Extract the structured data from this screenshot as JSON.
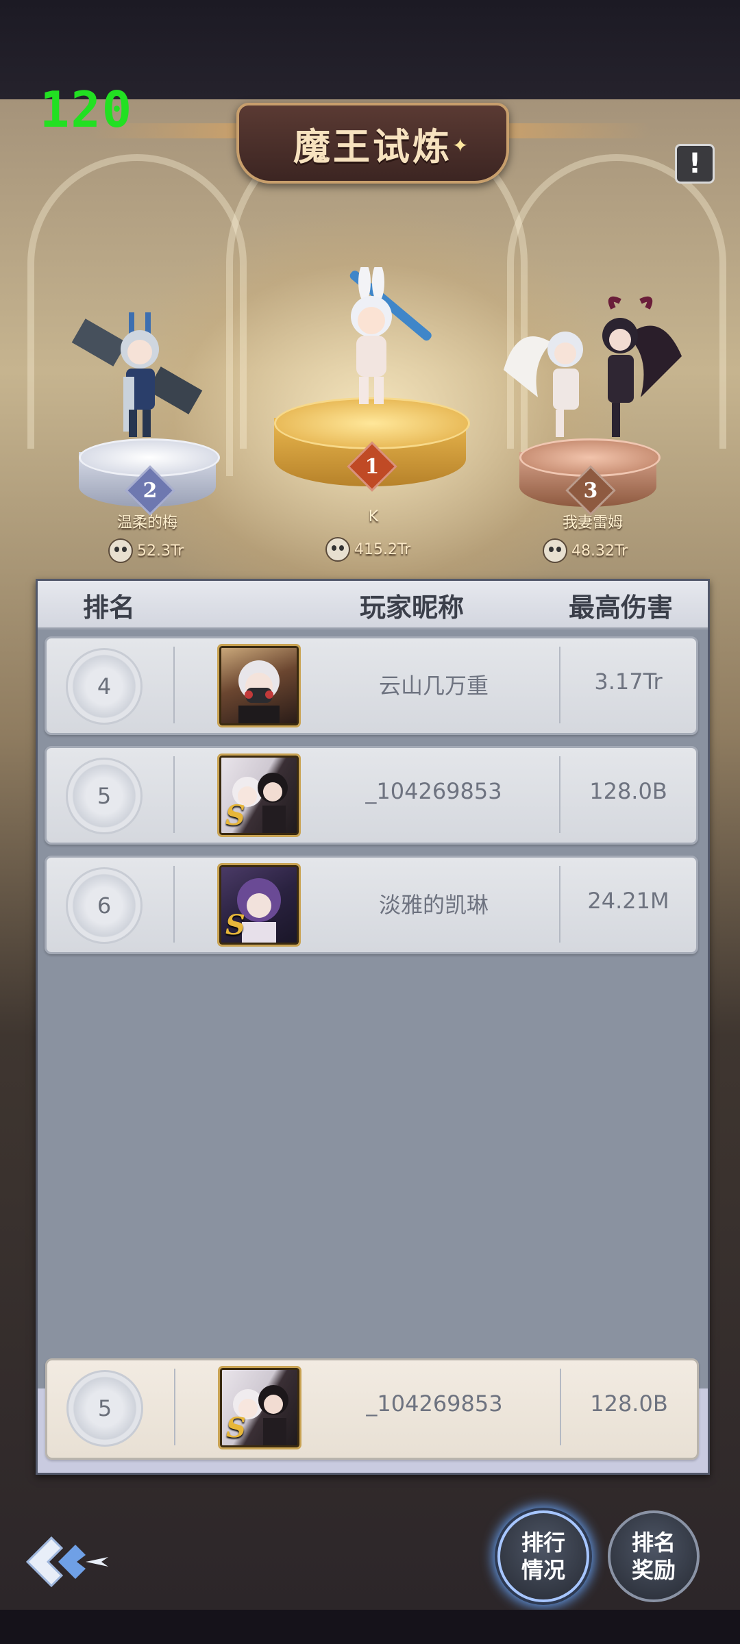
{
  "fps_counter": "120",
  "title": "魔王试炼",
  "info_icon": "exclamation-icon",
  "podium": [
    {
      "rank": "2",
      "name": "温柔的梅",
      "damage": "52.3Tr",
      "badge_color": "#6e78b0"
    },
    {
      "rank": "1",
      "name": "K",
      "damage": "415.2Tr",
      "badge_color": "#c04a25"
    },
    {
      "rank": "3",
      "name": "我妻雷姆",
      "damage": "48.32Tr",
      "badge_color": "#8e5a40"
    }
  ],
  "list": {
    "headers": {
      "rank": "排名",
      "nickname": "玩家昵称",
      "damage": "最高伤害"
    },
    "rows": [
      {
        "rank": "4",
        "nickname": "云山几万重",
        "damage": "3.17Tr"
      },
      {
        "rank": "5",
        "nickname": "_104269853",
        "damage": "128.0B"
      },
      {
        "rank": "6",
        "nickname": "淡雅的凯琳",
        "damage": "24.21M"
      }
    ],
    "my_row": {
      "rank": "5",
      "nickname": "_104269853",
      "damage": "128.0B"
    }
  },
  "avatar_badge": "S",
  "buttons": {
    "ranking_status": {
      "line1": "排行",
      "line2": "情况"
    },
    "rank_rewards": {
      "line1": "排名",
      "line2": "奖励"
    }
  }
}
